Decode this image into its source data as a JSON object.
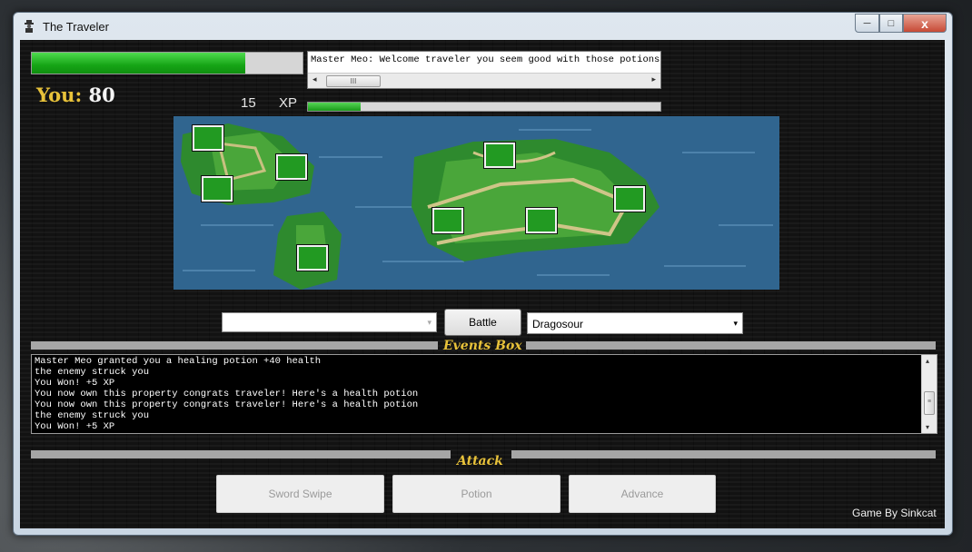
{
  "window": {
    "title": "The Traveler",
    "icon": "traveler-icon",
    "controls": {
      "minimize": "─",
      "maximize": "□",
      "close": "x"
    }
  },
  "player": {
    "label": "You:",
    "health": "80",
    "health_fraction": 0.79
  },
  "xp": {
    "value": "15",
    "label": "XP",
    "fraction": 0.15
  },
  "message": {
    "text": "Master Meo: Welcome traveler you seem good with those potions an",
    "scroll_left": "◂",
    "scroll_right": "▸",
    "thumb_grip": "III"
  },
  "colors": {
    "accent_gold": "#e8c23a",
    "health_green": "#16a516",
    "tile_green": "#229a22",
    "sea_blue": "#30658f"
  },
  "map": {
    "tiles": [
      "tile-1",
      "tile-2",
      "tile-3",
      "tile-4",
      "tile-5",
      "tile-6",
      "tile-7",
      "tile-8"
    ]
  },
  "controls": {
    "location_select": {
      "value": "",
      "arrow": "▾"
    },
    "battle_label": "Battle",
    "enemy_select": {
      "value": "Dragosour",
      "arrow": "▾"
    }
  },
  "events": {
    "title": "Events Box",
    "lines": [
      "Master Meo granted you a healing potion +40 health",
      "the enemy struck you",
      "You Won! +5 XP",
      "You now own this property congrats traveler! Here's a health potion",
      "You now own this property congrats traveler! Here's a health potion",
      "the enemy struck you",
      "You Won! +5 XP"
    ],
    "scroll_up": "▴",
    "scroll_down": "▾",
    "thumb_grip": "≡"
  },
  "attack": {
    "title": "Attack",
    "buttons": {
      "sword": "Sword Swipe",
      "potion": "Potion",
      "advance": "Advance"
    }
  },
  "credit": "Game By Sinkcat"
}
